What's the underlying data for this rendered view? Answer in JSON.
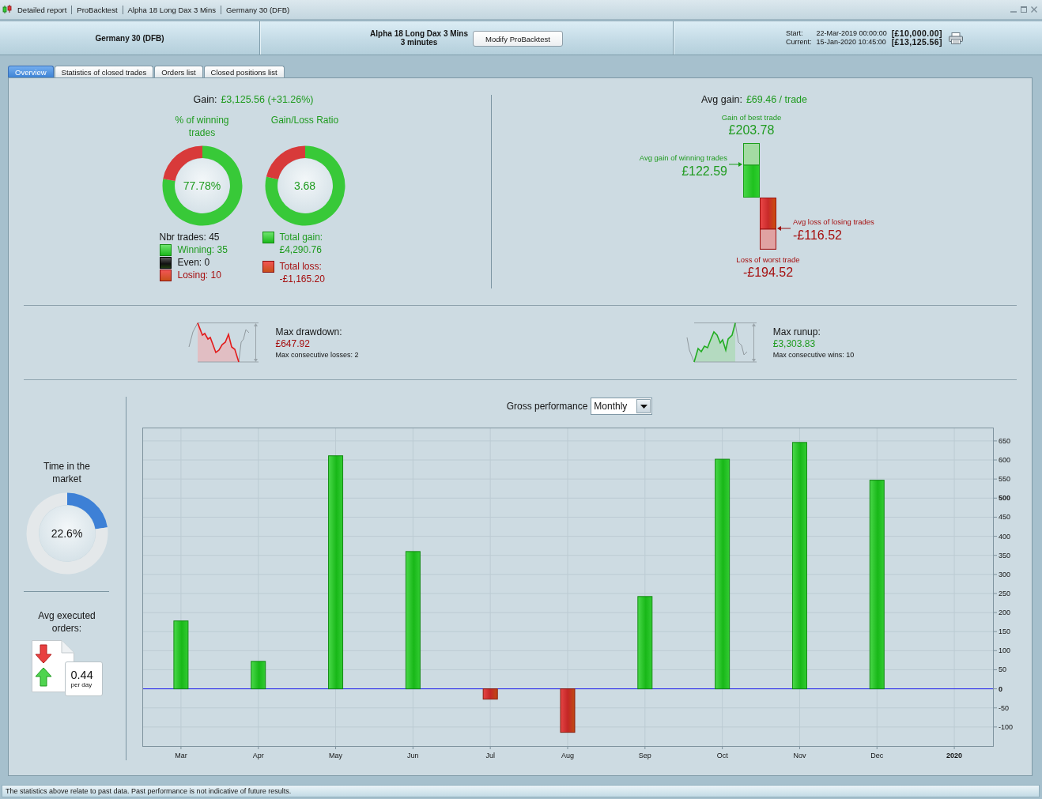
{
  "title_bar": {
    "breadcrumbs": [
      "Detailed report",
      "ProBacktest",
      "Alpha 18 Long Dax 3 Mins",
      "Germany 30 (DFB)"
    ]
  },
  "header": {
    "instrument": "Germany 30 (DFB)",
    "strategy": "Alpha 18 Long Dax 3 Mins",
    "timeframe": "3 minutes",
    "modify_button": "Modify ProBacktest",
    "dates": [
      {
        "label": "Start:",
        "date": "22-Mar-2019 00:00:00",
        "capital": "[£10,000.00]"
      },
      {
        "label": "Current:",
        "date": "15-Jan-2020 10:45:00",
        "capital": "[£13,125.56]"
      }
    ]
  },
  "tabs": [
    {
      "label": "Overview",
      "selected": true
    },
    {
      "label": "Statistics of closed trades",
      "selected": false
    },
    {
      "label": "Orders list",
      "selected": false
    },
    {
      "label": "Closed positions list",
      "selected": false
    }
  ],
  "gain": {
    "label": "Gain:",
    "value": "£3,125.56 (+31.26%)",
    "gauges": [
      {
        "title": "% of winning trades",
        "reading": "77.78%",
        "chart_data": {
          "type": "donut",
          "values": [
            77.78,
            22.22
          ]
        }
      },
      {
        "title": "Gain/Loss Ratio",
        "reading": "3.68",
        "chart_data": {
          "type": "donut",
          "values": [
            78.65,
            21.35
          ]
        }
      }
    ],
    "trades": {
      "total": "Nbr trades: 45",
      "items": [
        {
          "kind": "win",
          "text": "Winning: 35"
        },
        {
          "kind": "even",
          "text": "Even: 0"
        },
        {
          "kind": "loss",
          "text": "Losing: 10"
        }
      ]
    },
    "totals": [
      {
        "kind": "win",
        "label": "Total gain:",
        "value": "£4,290.76"
      },
      {
        "kind": "loss",
        "label": "Total loss:",
        "value": "-£1,165.20"
      }
    ]
  },
  "avg_gain": {
    "label": "Avg gain:",
    "value": "£69.46 / trade",
    "best": {
      "label": "Gain of best trade",
      "value": "£203.78"
    },
    "avg_win": {
      "label": "Avg gain of winning trades",
      "value": "£122.59"
    },
    "avg_loss": {
      "label": "Avg loss of losing trades",
      "value": "-£116.52"
    },
    "worst": {
      "label": "Loss of worst trade",
      "value": "-£194.52"
    }
  },
  "extremes": [
    {
      "kind": "drawdown",
      "title": "Max drawdown:",
      "value": "£647.92",
      "note": "Max consecutive losses: 2"
    },
    {
      "kind": "runup",
      "title": "Max runup:",
      "value": "£3,303.83",
      "note": "Max consecutive wins: 10"
    }
  ],
  "time_in_market": {
    "title": "Time in the market",
    "reading": "22.6%",
    "chart_data": {
      "type": "donut",
      "values": [
        22.6,
        77.4
      ]
    }
  },
  "orders": {
    "title": "Avg executed orders:",
    "value": "0.44",
    "unit": "per day"
  },
  "performance": {
    "label": "Gross performance",
    "period": "Monthly",
    "chart_data": {
      "type": "bar",
      "categories": [
        "Mar",
        "Apr",
        "May",
        "Jun",
        "Jul",
        "Aug",
        "Sep",
        "Oct",
        "Nov",
        "Dec",
        "2020"
      ],
      "values": [
        178,
        72,
        611,
        360,
        -27,
        -114,
        242,
        602,
        646,
        547,
        null
      ],
      "ylim": [
        -150,
        685
      ],
      "yticks": [
        -100,
        -50,
        0,
        50,
        100,
        150,
        200,
        250,
        300,
        350,
        400,
        450,
        500,
        550,
        600,
        650
      ],
      "grid": true,
      "ref_lines": [
        {
          "axis": "y",
          "value": 0,
          "color": "#2222ee"
        }
      ]
    }
  },
  "footer": "The statistics above relate to past data. Past performance is not indicative of future results."
}
